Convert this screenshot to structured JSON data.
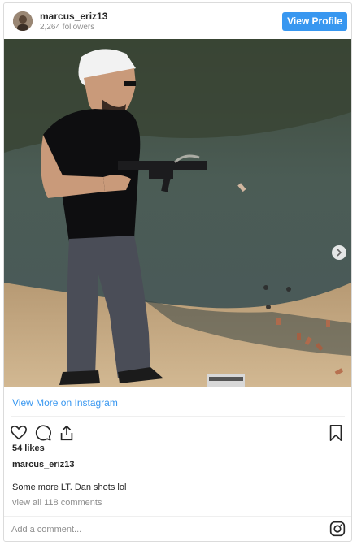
{
  "header": {
    "username": "marcus_eriz13",
    "followers": "2,264 followers",
    "view_profile_label": "View Profile",
    "avatar_icon": "user-avatar"
  },
  "post": {
    "view_more_label": "View More on Instagram",
    "likes": "54 likes",
    "caption_username": "marcus_eriz13",
    "caption": "Some more LT. Dan shots lol",
    "comments_link": "view all 118 comments",
    "comment_placeholder": "Add a comment...",
    "icons": [
      "heart-icon",
      "comment-icon",
      "share-icon",
      "bookmark-icon",
      "instagram-icon",
      "chevron-right-icon"
    ]
  },
  "colors": {
    "accent": "#3897f0",
    "text": "#262626",
    "muted": "#8e8e8e",
    "border": "#dbdbdb"
  }
}
